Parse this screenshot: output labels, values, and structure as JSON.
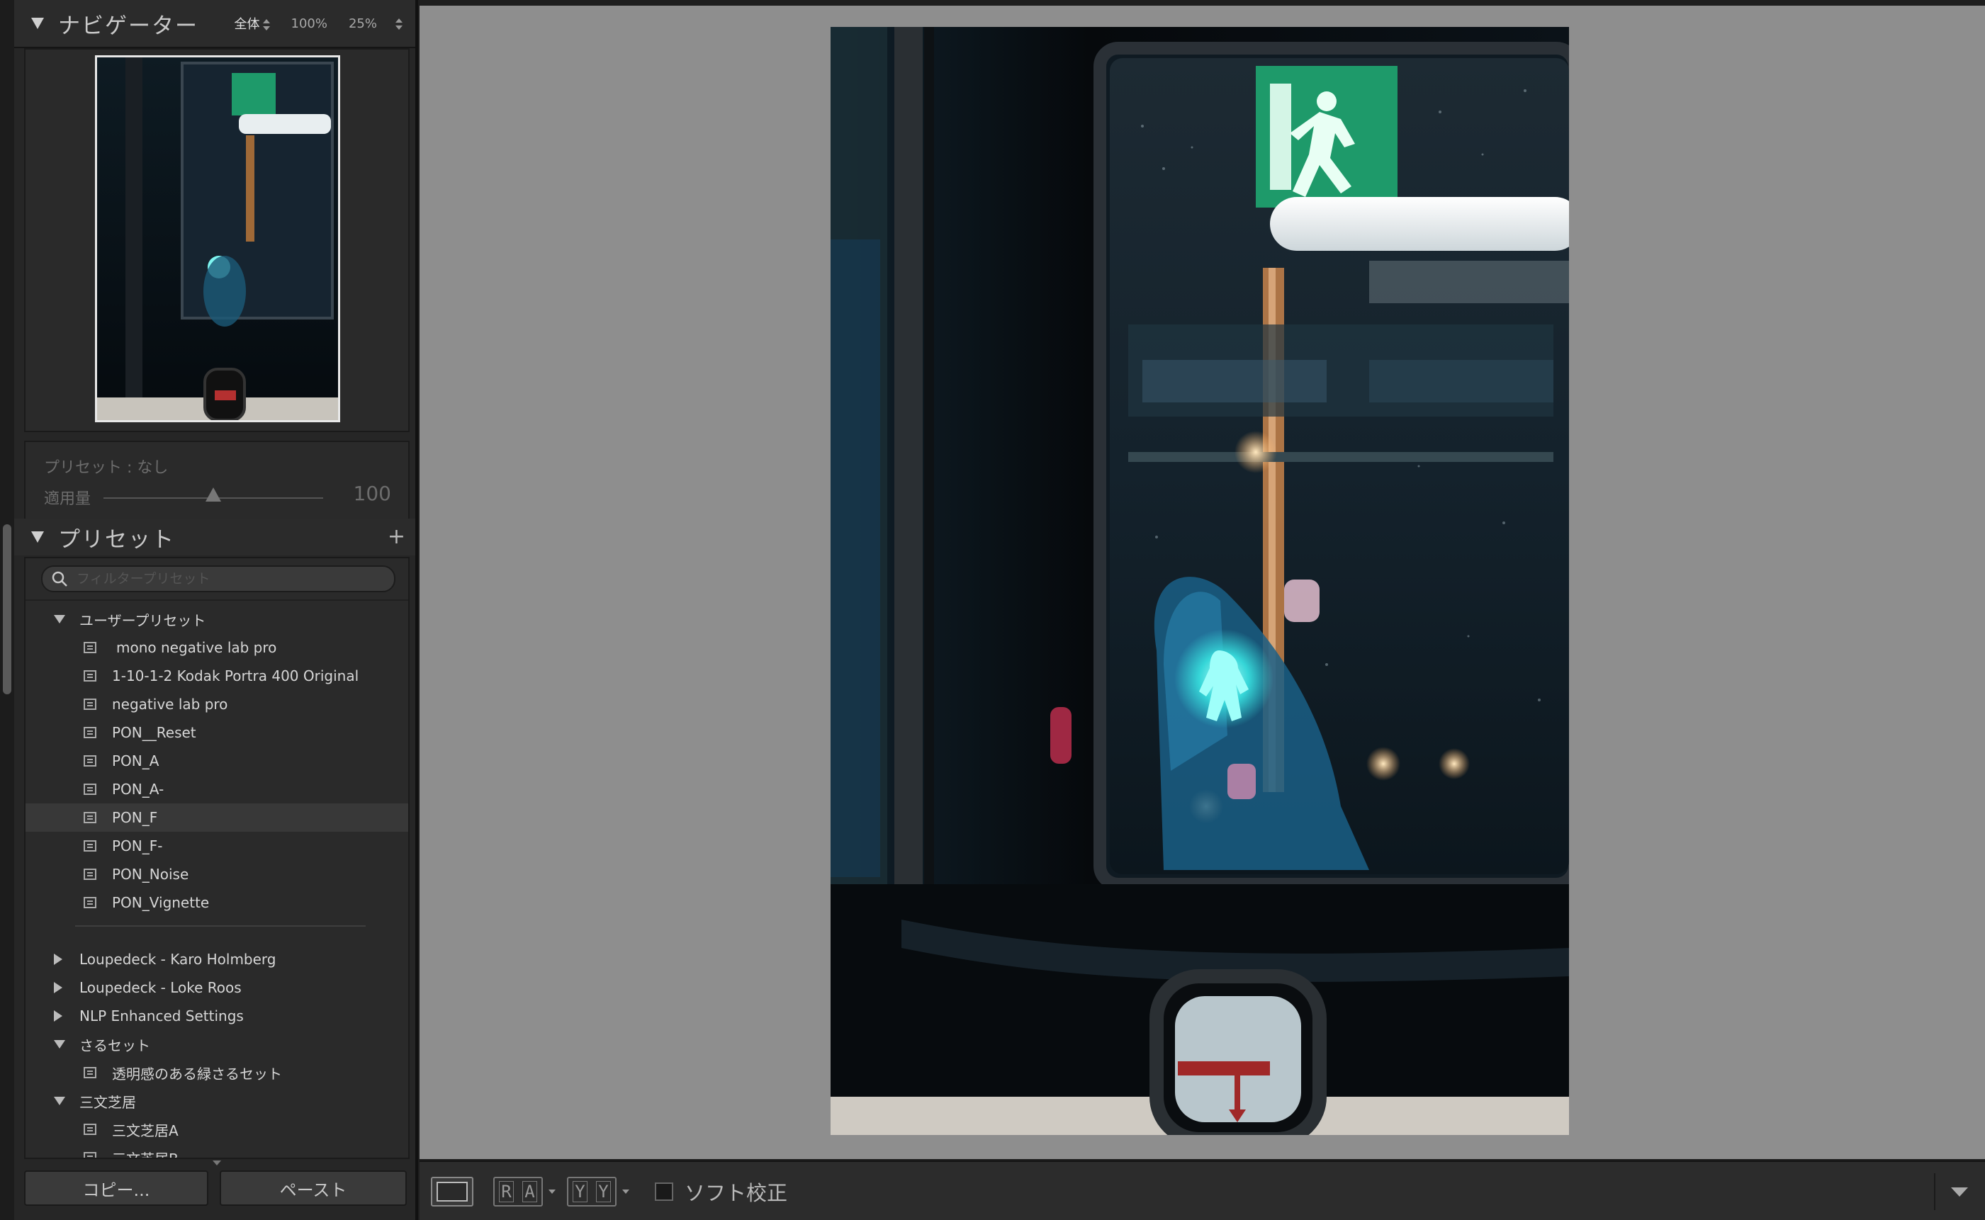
{
  "navigator": {
    "title": "ナビゲーター",
    "zoom_options": [
      "全体",
      "100%",
      "25%"
    ]
  },
  "preset_amount": {
    "preset_label": "プリセット : なし",
    "amount_label": "適用量",
    "amount_value": "100",
    "amount_fraction": 0.5
  },
  "presets": {
    "title": "プリセット",
    "add_symbol": "+",
    "search_placeholder": "フィルタープリセット",
    "groups": [
      {
        "name": "ユーザープリセット",
        "expanded": true,
        "items": [
          "mono negative lab pro",
          "1-10-1-2 Kodak Portra 400 Original",
          "negative lab pro",
          "PON__Reset",
          "PON_A",
          "PON_A-",
          "PON_F",
          "PON_F-",
          "PON_Noise",
          "PON_Vignette"
        ],
        "selected": "PON_F"
      },
      {
        "name": "Loupedeck - Karo Holmberg",
        "expanded": false,
        "items": []
      },
      {
        "name": "Loupedeck - Loke Roos",
        "expanded": false,
        "items": []
      },
      {
        "name": "NLP Enhanced Settings",
        "expanded": false,
        "items": []
      },
      {
        "name": "さるセット",
        "expanded": true,
        "items": [
          "透明感のある緑さるセット"
        ]
      },
      {
        "name": "三文芝居",
        "expanded": true,
        "items": [
          "三文芝居A",
          "三文芝居B"
        ]
      }
    ]
  },
  "buttons": {
    "copy": "コピー...",
    "paste": "ペースト"
  },
  "toolbar": {
    "compare_ra": [
      "R",
      "A"
    ],
    "compare_yy": [
      "Y",
      "Y"
    ],
    "soft_proof_label": "ソフト校正"
  },
  "colors": {
    "canvas_bg": "#8e8e8e",
    "panel_bg": "#262626",
    "exit_sign_green": "#1e9a6a",
    "cyan_signal": "#7ff5f0"
  }
}
